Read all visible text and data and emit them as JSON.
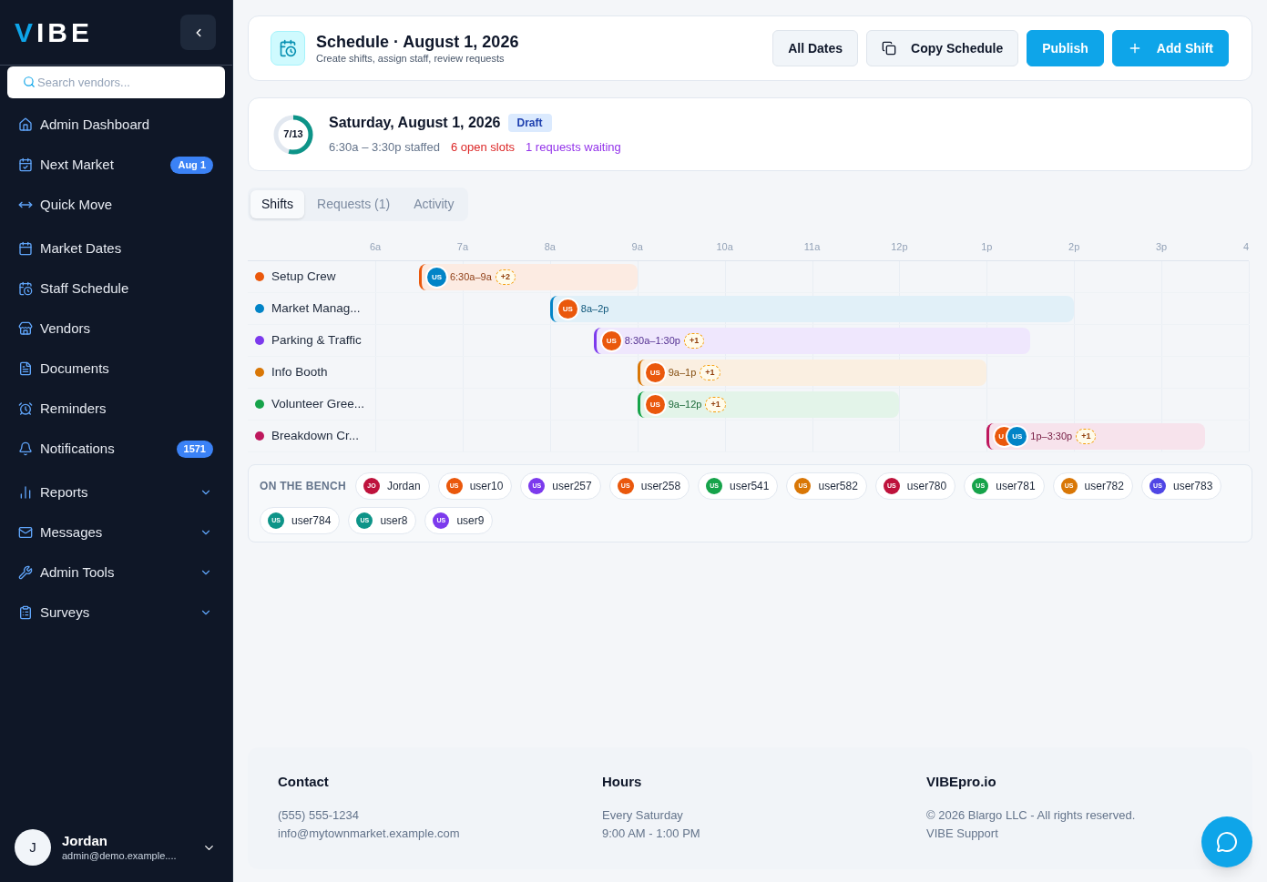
{
  "sidebar": {
    "logo": "VIBE",
    "search": {
      "placeholder": "Search vendors..."
    },
    "nav_groups": [
      {
        "items": [
          {
            "label": "Admin Dashboard",
            "kind": "link"
          },
          {
            "label": "Next Market",
            "kind": "link",
            "badge": "Aug 1"
          },
          {
            "label": "Quick Move",
            "kind": "link"
          }
        ]
      },
      {
        "items": [
          {
            "label": "Market Dates",
            "kind": "link"
          },
          {
            "label": "Staff Schedule",
            "kind": "link"
          },
          {
            "label": "Vendors",
            "kind": "link"
          },
          {
            "label": "Documents",
            "kind": "link"
          },
          {
            "label": "Reminders",
            "kind": "link"
          },
          {
            "label": "Notifications",
            "kind": "link",
            "badge": "1571"
          }
        ]
      },
      {
        "items": [
          {
            "label": "Reports",
            "kind": "group",
            "expanded": false
          },
          {
            "label": "Messages",
            "kind": "group",
            "expanded": false
          },
          {
            "label": "Admin Tools",
            "kind": "group",
            "expanded": false
          },
          {
            "label": "Surveys",
            "kind": "group",
            "expanded": false
          }
        ]
      }
    ],
    "user": {
      "initial": "J",
      "name": "Jordan",
      "email": "admin@demo.example...."
    }
  },
  "header": {
    "title": "Schedule · August 1, 2026",
    "subtitle": "Create shifts, assign staff, review requests",
    "buttons": [
      {
        "label": "All Dates",
        "kind": "secondary"
      },
      {
        "label": "Copy Schedule",
        "kind": "secondary"
      },
      {
        "label": "Publish",
        "kind": "primary"
      },
      {
        "label": "Add Shift",
        "kind": "primary"
      }
    ]
  },
  "day": {
    "ring": {
      "label": "7/13",
      "level": 0.538
    },
    "title": "Saturday, August 1, 2026",
    "status": "Draft",
    "stats": [
      {
        "text": "6:30a – 3:30p staffed",
        "color": "#64748b"
      },
      {
        "text": "6 open slots",
        "color": "#dc2626"
      },
      {
        "text": "1 requests waiting",
        "color": "#9333ea"
      }
    ]
  },
  "tabs": [
    {
      "label": "Shifts",
      "selected": true
    },
    {
      "label": "Requests (1)",
      "selected": false
    },
    {
      "label": "Activity",
      "selected": false
    }
  ],
  "timeline": {
    "hours": [
      "6a",
      "7a",
      "8a",
      "9a",
      "10a",
      "11a",
      "12p",
      "1p",
      "2p",
      "3p",
      "4"
    ],
    "rows": [
      {
        "name": "Setup Crew",
        "color": "#ea580c",
        "shift": {
          "time": "6:30a–9a",
          "avatars": [
            {
              "initials": "US",
              "color": "#0284c7"
            }
          ],
          "extra": "+2"
        }
      },
      {
        "name": "Market Manag...",
        "color": "#0284c7",
        "shift": {
          "time": "8a–2p",
          "avatars": [
            {
              "initials": "US",
              "color": "#ea580c"
            }
          ]
        }
      },
      {
        "name": "Parking & Traffic",
        "color": "#7c3aed",
        "shift": {
          "time": "8:30a–1:30p",
          "avatars": [
            {
              "initials": "US",
              "color": "#ea580c"
            }
          ],
          "extra": "+1"
        }
      },
      {
        "name": "Info Booth",
        "color": "#d97706",
        "shift": {
          "time": "9a–1p",
          "avatars": [
            {
              "initials": "US",
              "color": "#ea580c"
            }
          ],
          "extra": "+1"
        }
      },
      {
        "name": "Volunteer Gree...",
        "color": "#16a34a",
        "shift": {
          "time": "9a–12p",
          "avatars": [
            {
              "initials": "US",
              "color": "#ea580c"
            }
          ],
          "extra": "+1"
        }
      },
      {
        "name": "Breakdown Cr...",
        "color": "#be185d",
        "shift": {
          "time": "1p–3:30p",
          "avatars": [
            {
              "initials": "U",
              "color": "#ea580c"
            },
            {
              "initials": "US",
              "color": "#0284c7"
            }
          ],
          "extra": "+1"
        }
      }
    ]
  },
  "bench": {
    "label": "ON THE BENCH",
    "people": [
      {
        "initials": "JO",
        "name": "Jordan",
        "color": "#be123c"
      },
      {
        "initials": "US",
        "name": "user10",
        "color": "#ea580c"
      },
      {
        "initials": "US",
        "name": "user257",
        "color": "#7c3aed"
      },
      {
        "initials": "US",
        "name": "user258",
        "color": "#ea580c"
      },
      {
        "initials": "US",
        "name": "user541",
        "color": "#16a34a"
      },
      {
        "initials": "US",
        "name": "user582",
        "color": "#d97706"
      },
      {
        "initials": "US",
        "name": "user780",
        "color": "#be123c"
      },
      {
        "initials": "US",
        "name": "user781",
        "color": "#16a34a"
      },
      {
        "initials": "US",
        "name": "user782",
        "color": "#d97706"
      },
      {
        "initials": "US",
        "name": "user783",
        "color": "#4f46e5"
      },
      {
        "initials": "US",
        "name": "user784",
        "color": "#0d9488"
      },
      {
        "initials": "US",
        "name": "user8",
        "color": "#0d9488"
      },
      {
        "initials": "US",
        "name": "user9",
        "color": "#7c3aed"
      }
    ]
  },
  "footer": {
    "columns": [
      {
        "title": "Contact",
        "lines": [
          "(555) 555-1234",
          "info@mytownmarket.example.com"
        ]
      },
      {
        "title": "Hours",
        "lines": [
          "Every Saturday",
          "9:00 AM - 1:00 PM"
        ]
      },
      {
        "title": "VIBEpro.io",
        "lines": [
          "© 2026 Blargo LLC - All rights reserved.",
          "VIBE Support"
        ]
      }
    ]
  }
}
